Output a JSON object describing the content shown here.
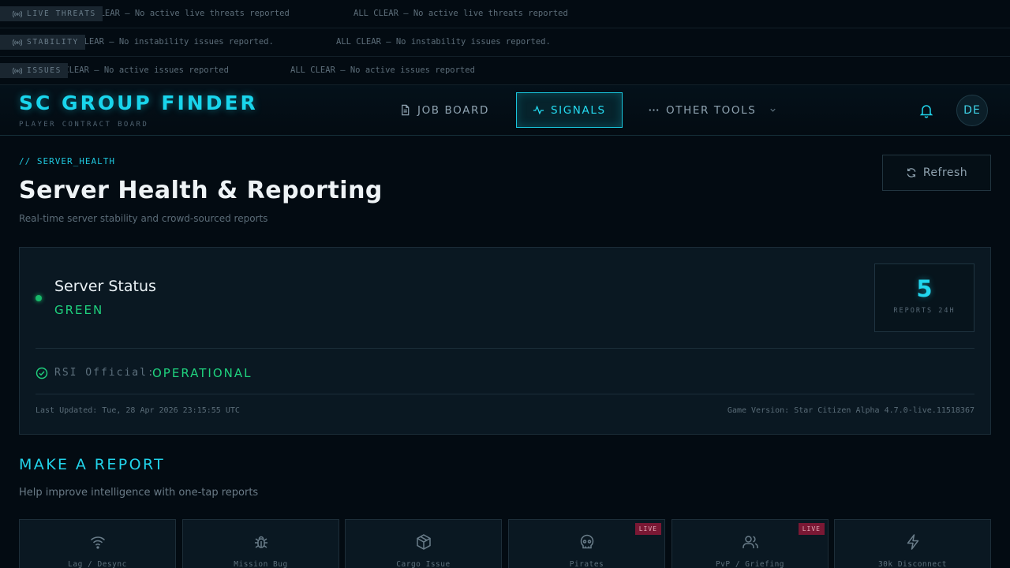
{
  "tickers": [
    {
      "tag": "LIVE THREATS",
      "message": "ALL CLEAR — No active live threats reported"
    },
    {
      "tag": "STABILITY",
      "message": "ALL CLEAR — No instability issues reported."
    },
    {
      "tag": "ISSUES",
      "message": "ALL CLEAR — No active issues reported"
    }
  ],
  "header": {
    "title": "SC GROUP FINDER",
    "subtitle": "PLAYER CONTRACT BOARD",
    "nav": {
      "job_board": "JOB BOARD",
      "signals": "SIGNALS",
      "other_tools": "OTHER TOOLS"
    },
    "avatar_initials": "DE"
  },
  "page": {
    "breadcrumb": "// SERVER_HEALTH",
    "title": "Server Health & Reporting",
    "subtitle": "Real-time server stability and crowd-sourced reports",
    "refresh_label": "Refresh"
  },
  "status": {
    "label": "Server Status",
    "value": "GREEN",
    "reports_count": "5",
    "reports_label": "REPORTS 24H",
    "rsi_label": "RSI Official:",
    "rsi_value": "OPERATIONAL",
    "last_updated": "Last Updated: Tue, 28 Apr 2026 23:15:55 UTC",
    "game_version": "Game Version: Star Citizen Alpha 4.7.0-live.11518367"
  },
  "report": {
    "title": "MAKE A REPORT",
    "subtitle": "Help improve intelligence with one-tap reports",
    "live_badge": "LIVE",
    "tiles": [
      {
        "label": "Lag / Desync",
        "icon": "wifi-icon"
      },
      {
        "label": "Mission Bug",
        "icon": "bug-icon"
      },
      {
        "label": "Cargo Issue",
        "icon": "box-icon"
      },
      {
        "label": "Pirates",
        "icon": "skull-icon"
      },
      {
        "label": "PvP / Griefing",
        "icon": "users-icon"
      },
      {
        "label": "30k Disconnect",
        "icon": "lightning-icon"
      }
    ]
  },
  "colors": {
    "accent": "#19d5ec",
    "status_green": "#1fd27e",
    "live_badge": "#7a1834",
    "background": "#030b12"
  }
}
